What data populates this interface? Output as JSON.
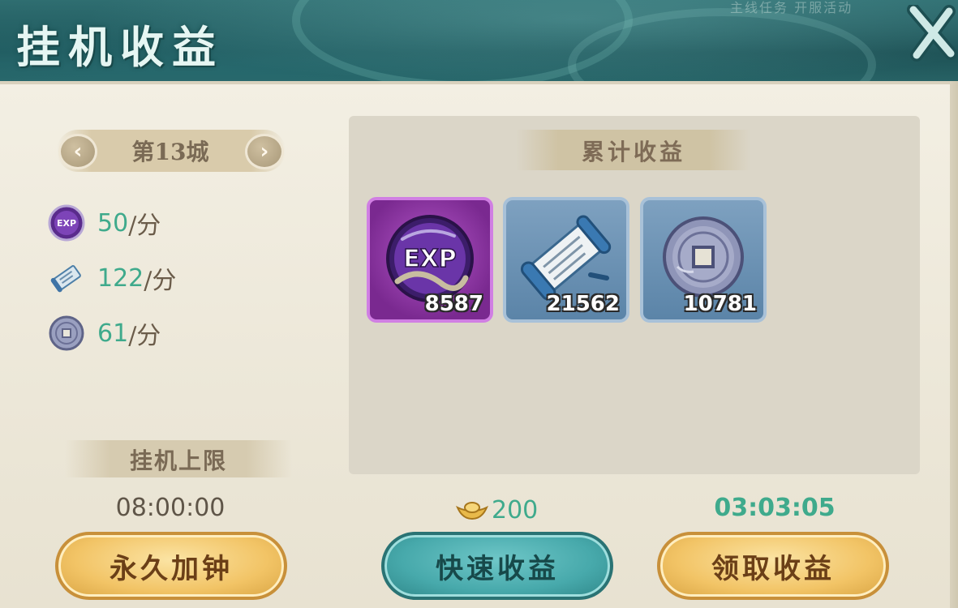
{
  "header": {
    "title": "挂机收益",
    "faded_text": "主线任务  开服活动",
    "close_icon": "close-x-icon"
  },
  "city_selector": {
    "label": "第13城",
    "prev_icon": "chevron-left-icon",
    "next_icon": "chevron-right-icon"
  },
  "rates": [
    {
      "icon": "exp-orb-icon",
      "value": "50",
      "unit": "/分"
    },
    {
      "icon": "scroll-icon",
      "value": "122",
      "unit": "/分"
    },
    {
      "icon": "coin-icon",
      "value": "61",
      "unit": "/分"
    }
  ],
  "accumulated": {
    "title": "累计收益",
    "items": [
      {
        "icon": "exp-orb-icon",
        "orb_text": "EXP",
        "count": "8587"
      },
      {
        "icon": "scroll-icon",
        "count": "21562"
      },
      {
        "icon": "coin-icon",
        "count": "10781"
      }
    ]
  },
  "limit": {
    "title": "挂机上限",
    "time": "08:00:00"
  },
  "cost": {
    "icon": "gold-ingot-icon",
    "value": "200"
  },
  "timer": "03:03:05",
  "buttons": {
    "forever": "永久加钟",
    "fast": "快速收益",
    "claim": "领取收益"
  },
  "colors": {
    "accent_green": "#3faa8c",
    "header_teal": "#1d5155",
    "panel_bg": "#f3efe3",
    "gold_button": "#f2c466",
    "teal_button": "#47a9ab"
  }
}
